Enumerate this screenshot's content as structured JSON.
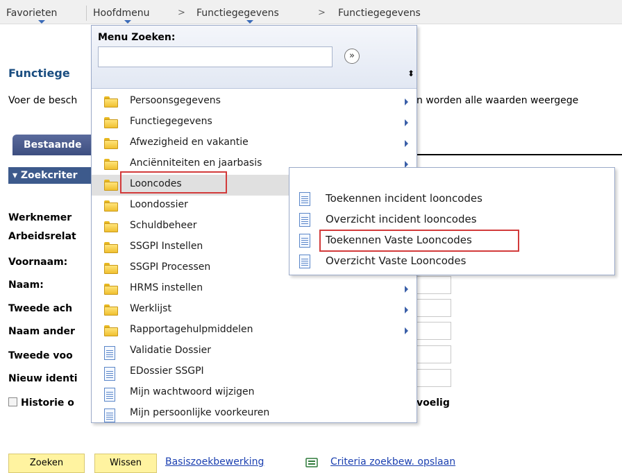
{
  "topnav": {
    "favorites": "Favorieten",
    "mainmenu": "Hoofdmenu",
    "crumb_sep": ">",
    "crumb1": "Functiegegevens",
    "crumb2": "Functiegegevens"
  },
  "page": {
    "title": "Functiege",
    "instruction_left": "Voer de besch",
    "instruction_right": "n worden alle waarden weergege",
    "tab_existing": "Bestaande",
    "section_search": "▾ Zoekcriter",
    "labels": [
      "Werknemer",
      "Arbeidsrelat",
      "Voornaam:",
      "Naam:",
      "Tweede ach",
      "Naam ander",
      "Tweede voo",
      "Nieuw identi"
    ],
    "history_label": "Historie o",
    "history_suffix": "voelig",
    "buttons": {
      "search": "Zoeken",
      "clear": "Wissen"
    },
    "links": {
      "basic_search": "Basiszoekbewerking",
      "save_criteria": "Criteria zoekbew. opslaan"
    }
  },
  "menu": {
    "title": "Menu Zoeken:",
    "search_value": "",
    "go_symbol": "»",
    "sort_symbol": "⬍",
    "items": [
      {
        "label": "Persoonsgegevens",
        "icon": "folder",
        "submenu": true
      },
      {
        "label": "Functiegegevens",
        "icon": "folder",
        "submenu": true
      },
      {
        "label": "Afwezigheid en vakantie",
        "icon": "folder",
        "submenu": true
      },
      {
        "label": "Anciënniteiten en jaarbasis",
        "icon": "folder",
        "submenu": true
      },
      {
        "label": "Looncodes",
        "icon": "folder",
        "submenu": false,
        "highlighted": true
      },
      {
        "label": "Loondossier",
        "icon": "folder",
        "submenu": false
      },
      {
        "label": "Schuldbeheer",
        "icon": "folder",
        "submenu": false
      },
      {
        "label": "SSGPI Instellen",
        "icon": "folder",
        "submenu": false
      },
      {
        "label": "SSGPI Processen",
        "icon": "folder",
        "submenu": false
      },
      {
        "label": "HRMS instellen",
        "icon": "folder",
        "submenu": true
      },
      {
        "label": "Werklijst",
        "icon": "folder",
        "submenu": true
      },
      {
        "label": "Rapportagehulpmiddelen",
        "icon": "folder",
        "submenu": true
      },
      {
        "label": "Validatie Dossier",
        "icon": "document",
        "submenu": false
      },
      {
        "label": "EDossier SSGPI",
        "icon": "document",
        "submenu": false
      },
      {
        "label": "Mijn wachtwoord wijzigen",
        "icon": "document",
        "submenu": false
      },
      {
        "label": "Mijn persoonlijke voorkeuren",
        "icon": "document",
        "submenu": false
      }
    ]
  },
  "submenu": {
    "items": [
      {
        "label": "Toekennen incident looncodes",
        "icon": "document"
      },
      {
        "label": "Overzicht incident looncodes",
        "icon": "document"
      },
      {
        "label": "Toekennen Vaste Looncodes",
        "icon": "document",
        "highlighted": true
      },
      {
        "label": "Overzicht Vaste Looncodes",
        "icon": "document"
      }
    ]
  },
  "colors": {
    "accent": "#3d5a8c",
    "highlight_border": "#d23a3a",
    "button_bg": "#fff3a0",
    "link": "#1a3fb0"
  }
}
